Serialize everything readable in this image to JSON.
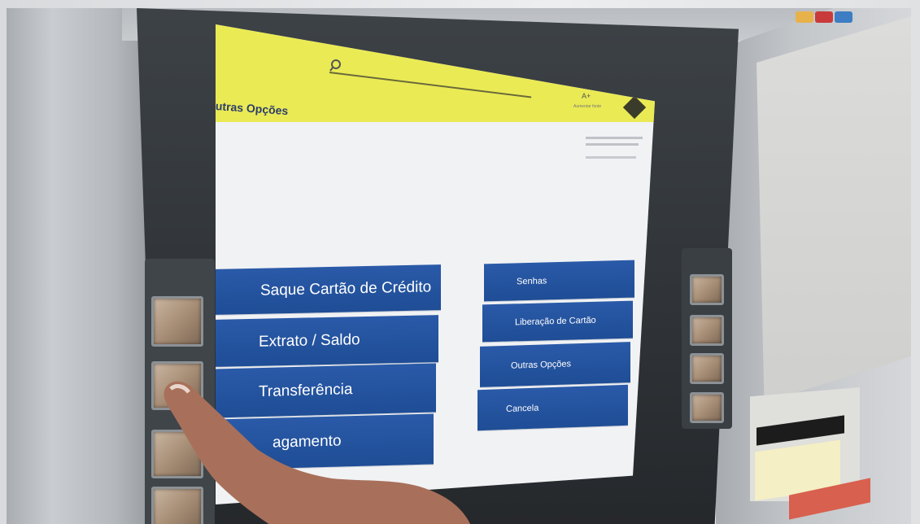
{
  "header": {
    "search_icon": "search-icon",
    "font_size_label": "A+",
    "font_size_sub": "Aumentar fonte"
  },
  "page": {
    "title": "utras Opções"
  },
  "menu": {
    "left": [
      {
        "label": "Saque Cartão de Crédito"
      },
      {
        "label": "Extrato / Saldo"
      },
      {
        "label": "Transferência"
      },
      {
        "label": "agamento"
      }
    ],
    "right": [
      {
        "label": "Senhas"
      },
      {
        "label": "Liberação de Cartão"
      },
      {
        "label": "Outras Opções"
      },
      {
        "label": "Cancela"
      }
    ]
  },
  "colors": {
    "header_bg": "#eaea55",
    "button_bg": "#2a5aa8",
    "title_color": "#2c3e6b"
  }
}
